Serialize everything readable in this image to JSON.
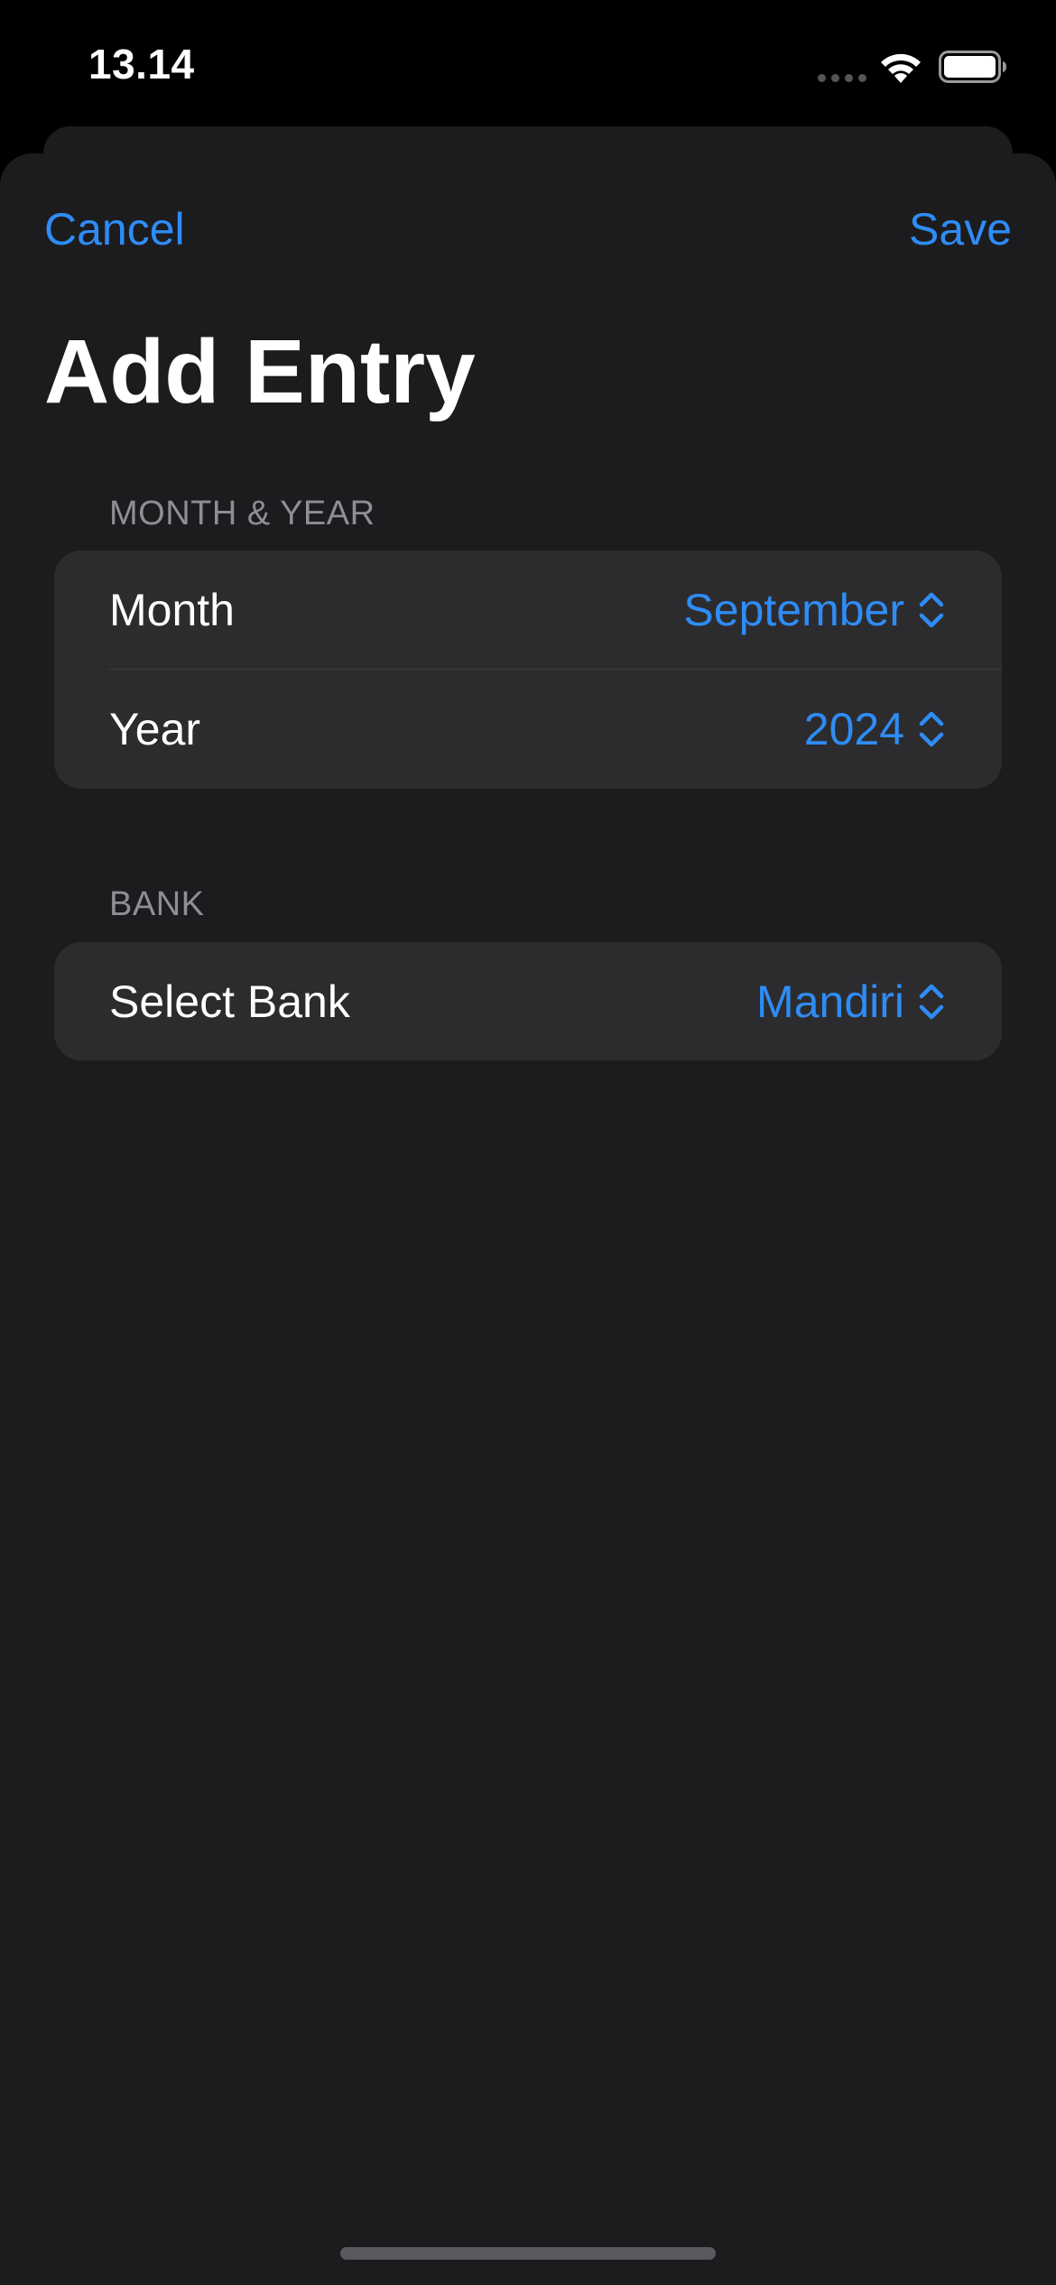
{
  "status_bar": {
    "time": "13.14",
    "icons": [
      "cellular-signal-icon",
      "wifi-icon",
      "battery-icon"
    ]
  },
  "nav": {
    "cancel_label": "Cancel",
    "save_label": "Save"
  },
  "title": "Add Entry",
  "sections": {
    "month_year": {
      "header": "MONTH & YEAR",
      "month_label": "Month",
      "month_value": "September",
      "year_label": "Year",
      "year_value": "2024"
    },
    "bank": {
      "header": "BANK",
      "bank_label": "Select Bank",
      "bank_value": "Mandiri"
    }
  },
  "colors": {
    "accent": "#2f8cf5",
    "sheet_background": "#1c1c1e",
    "group_background": "#2c2c2e",
    "secondary_text": "#8e8e93"
  }
}
